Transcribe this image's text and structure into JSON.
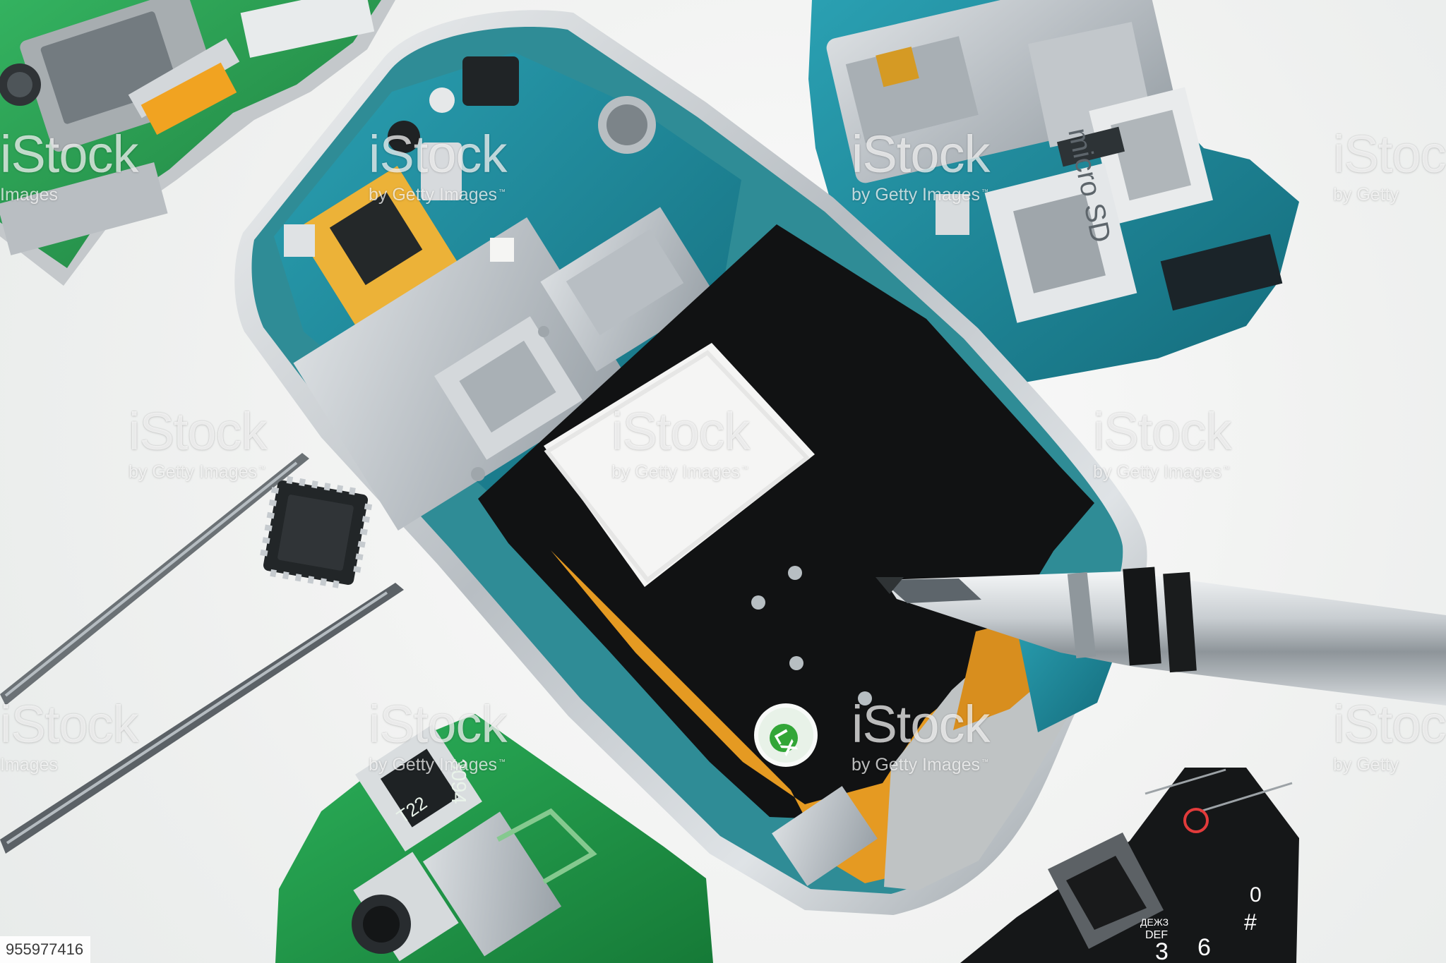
{
  "watermark": {
    "brand": "iStock",
    "byline": "by Getty Images",
    "byline_alt": "Images",
    "byline_short": "by Getty",
    "tm": "™"
  },
  "image_id": "955977416",
  "labels": {
    "micro_sd": "micro SD",
    "lx": "LX",
    "board_code": "3094",
    "board_tag": "T22"
  },
  "keypad": {
    "keys": [
      "3",
      "6",
      "#",
      "0"
    ],
    "def_label": "DEF",
    "cyr_label": "ДЕЖЗ"
  },
  "colors": {
    "background": "#f4f5f4",
    "pcb_blue": "#1e8a9b",
    "pcb_green": "#1f9a43",
    "battery_black": "#101112",
    "flex_orange": "#e59a22",
    "shield_silver": "#c7ccd0"
  }
}
